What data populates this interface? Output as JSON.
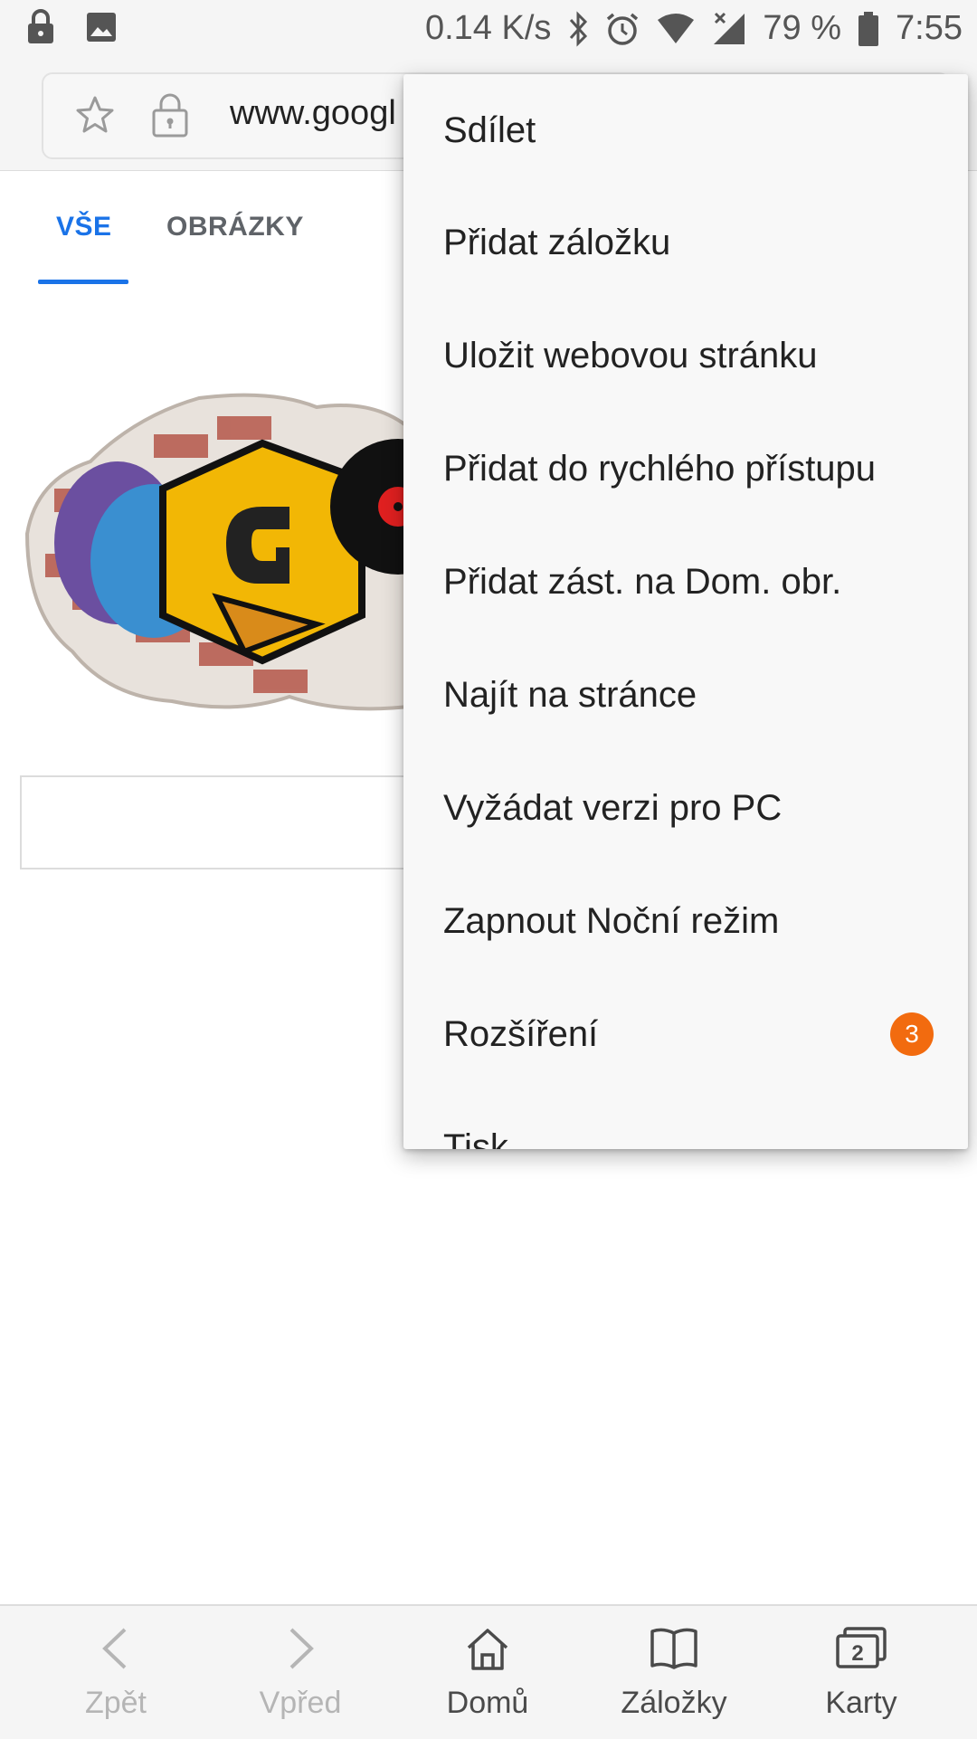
{
  "status_bar": {
    "speed": "0.14 K/s",
    "battery": "79 %",
    "time": "7:55",
    "icons": [
      "lock-icon",
      "image-icon",
      "bluetooth-icon",
      "alarm-icon",
      "wifi-icon",
      "signal-icon",
      "battery-icon"
    ]
  },
  "url_bar": {
    "url": "www.googl"
  },
  "tabs": [
    {
      "label": "VŠE",
      "active": true
    },
    {
      "label": "OBRÁZKY",
      "active": false
    }
  ],
  "menu": {
    "items": [
      {
        "label": "Sdílet"
      },
      {
        "label": "Přidat záložku"
      },
      {
        "label": "Uložit webovou stránku"
      },
      {
        "label": "Přidat do rychlého přístupu"
      },
      {
        "label": "Přidat zást. na Dom. obr."
      },
      {
        "label": "Najít na stránce"
      },
      {
        "label": "Vyžádat verzi pro PC"
      },
      {
        "label": "Zapnout Noční režim"
      },
      {
        "label": "Rozšíření",
        "badge": "3"
      },
      {
        "label": "Tisk"
      }
    ]
  },
  "bottom_nav": {
    "items": [
      {
        "label": "Zpět",
        "icon": "chevron-left-icon",
        "enabled": false
      },
      {
        "label": "Vpřed",
        "icon": "chevron-right-icon",
        "enabled": false
      },
      {
        "label": "Domů",
        "icon": "home-icon",
        "enabled": true
      },
      {
        "label": "Záložky",
        "icon": "bookmarks-icon",
        "enabled": true
      },
      {
        "label": "Karty",
        "icon": "tabs-icon",
        "enabled": true,
        "count": "2"
      }
    ]
  },
  "colors": {
    "accent": "#1a73e8",
    "badge": "#f26b0f"
  }
}
